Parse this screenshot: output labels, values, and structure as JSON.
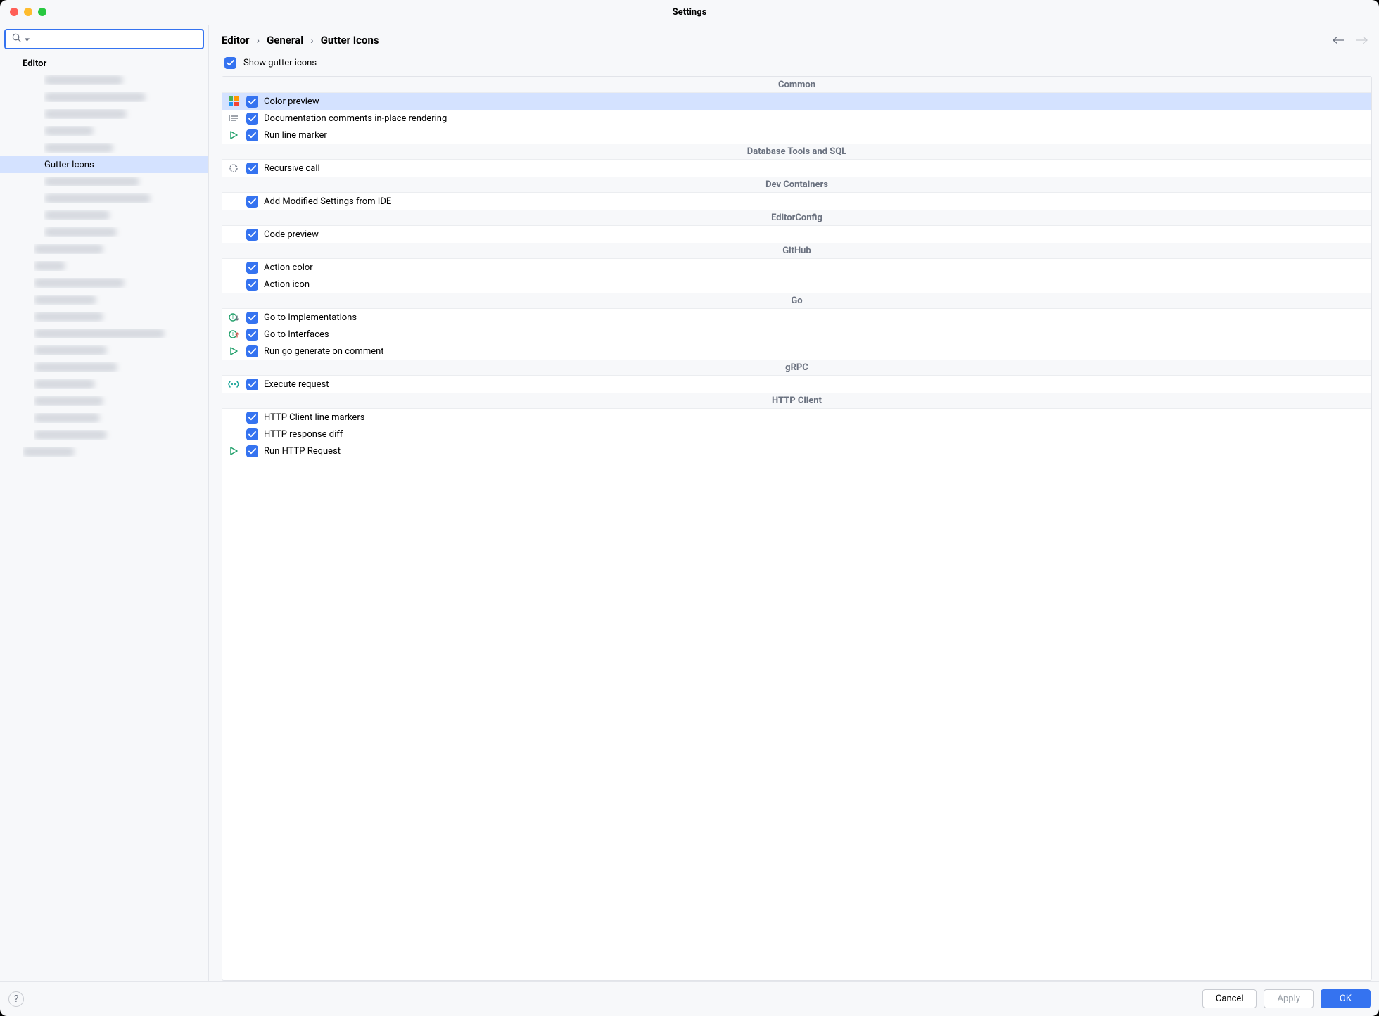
{
  "window": {
    "title": "Settings"
  },
  "search": {
    "placeholder": ""
  },
  "sidebar": {
    "category": "Editor",
    "selected": "Gutter Icons"
  },
  "breadcrumb": {
    "items": [
      "Editor",
      "General",
      "Gutter Icons"
    ]
  },
  "top_option": {
    "label": "Show gutter icons",
    "checked": true
  },
  "groups": [
    {
      "title": "Common",
      "items": [
        {
          "icon": "color-grid-icon",
          "label": "Color preview",
          "checked": true,
          "selected": true
        },
        {
          "icon": "doc-lines-icon",
          "label": "Documentation comments in-place rendering",
          "checked": true
        },
        {
          "icon": "run-play-icon",
          "label": "Run line marker",
          "checked": true
        }
      ]
    },
    {
      "title": "Database Tools and SQL",
      "items": [
        {
          "icon": "recursive-icon",
          "label": "Recursive call",
          "checked": true
        }
      ]
    },
    {
      "title": "Dev Containers",
      "items": [
        {
          "icon": "",
          "label": "Add Modified Settings from IDE",
          "checked": true
        }
      ]
    },
    {
      "title": "EditorConfig",
      "items": [
        {
          "icon": "",
          "label": "Code preview",
          "checked": true
        }
      ]
    },
    {
      "title": "GitHub",
      "items": [
        {
          "icon": "",
          "label": "Action color",
          "checked": true
        },
        {
          "icon": "",
          "label": "Action icon",
          "checked": true
        }
      ]
    },
    {
      "title": "Go",
      "items": [
        {
          "icon": "impl-down-icon",
          "label": "Go to Implementations",
          "checked": true
        },
        {
          "icon": "impl-up-icon",
          "label": "Go to Interfaces",
          "checked": true
        },
        {
          "icon": "run-play-icon",
          "label": "Run go generate on comment",
          "checked": true
        }
      ]
    },
    {
      "title": "gRPC",
      "items": [
        {
          "icon": "grpc-icon",
          "label": "Execute request",
          "checked": true
        }
      ]
    },
    {
      "title": "HTTP Client",
      "items": [
        {
          "icon": "",
          "label": "HTTP Client line markers",
          "checked": true
        },
        {
          "icon": "",
          "label": "HTTP response diff",
          "checked": true
        },
        {
          "icon": "run-play-icon",
          "label": "Run HTTP Request",
          "checked": true
        }
      ]
    }
  ],
  "footer": {
    "cancel": "Cancel",
    "apply": "Apply",
    "ok": "OK"
  }
}
